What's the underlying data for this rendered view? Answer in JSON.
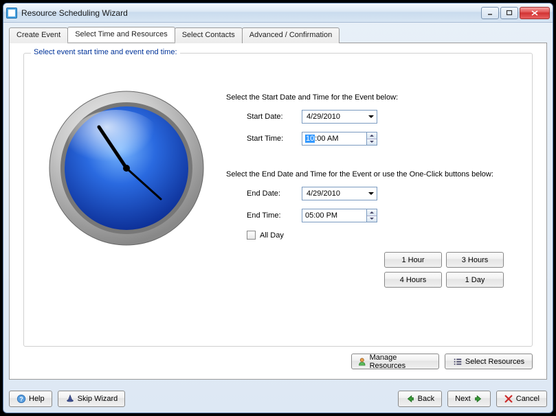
{
  "window": {
    "title": "Resource Scheduling Wizard"
  },
  "tabs": [
    {
      "label": "Create Event",
      "active": false
    },
    {
      "label": "Select Time and Resources",
      "active": true
    },
    {
      "label": "Select Contacts",
      "active": false
    },
    {
      "label": "Advanced / Confirmation",
      "active": false
    }
  ],
  "panel": {
    "legend": "Select event start time and event end time:",
    "start_section_label": "Select the Start Date and Time for the Event below:",
    "start_date_label": "Start Date:",
    "start_date_value": "4/29/2010",
    "start_time_label": "Start Time:",
    "start_time_sel": "10",
    "start_time_rest": ":00 AM",
    "end_section_label": "Select the End Date and Time for the Event or use the One-Click buttons below:",
    "end_date_label": "End Date:",
    "end_date_value": "4/29/2010",
    "end_time_label": "End Time:",
    "end_time_value": "05:00 PM",
    "all_day_label": "All Day",
    "quick": {
      "one_hour": "1 Hour",
      "three_hours": "3 Hours",
      "four_hours": "4 Hours",
      "one_day": "1 Day"
    }
  },
  "resource_bar": {
    "manage": "Manage Resources",
    "select": "Select Resources"
  },
  "footer": {
    "help": "Help",
    "skip": "Skip Wizard",
    "back": "Back",
    "next": "Next",
    "cancel": "Cancel"
  }
}
